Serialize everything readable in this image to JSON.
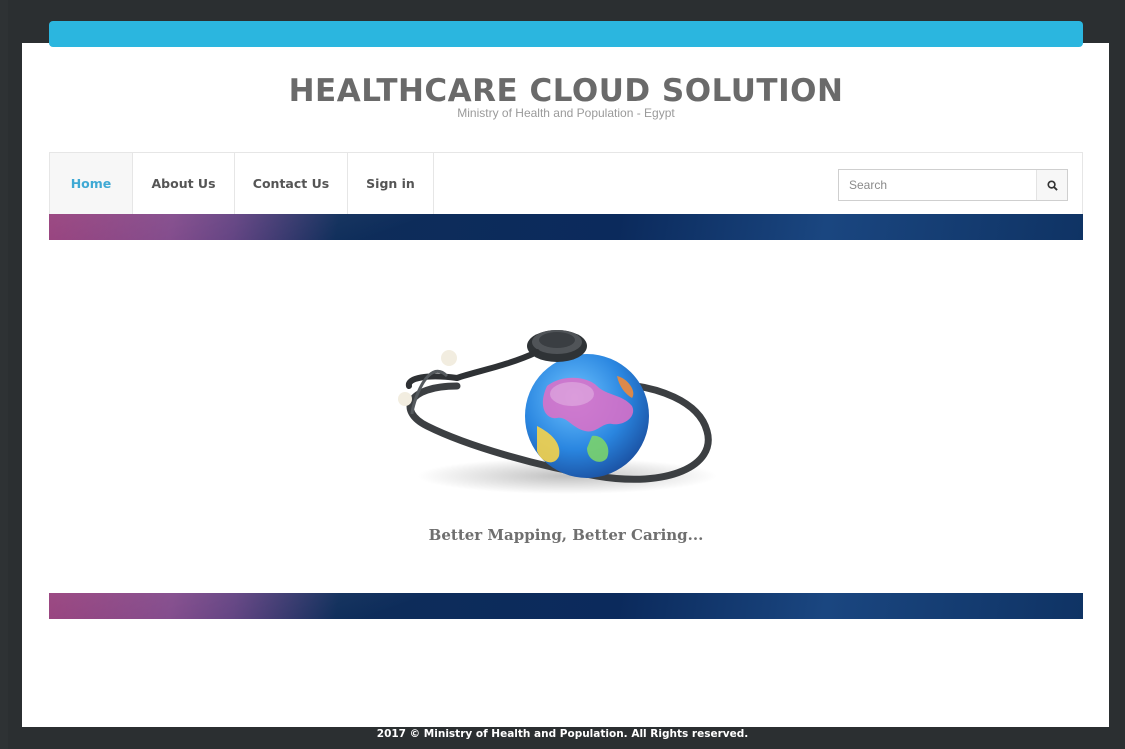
{
  "header": {
    "title": "HEALTHCARE CLOUD SOLUTION",
    "subtitle": "Ministry of Health and Population - Egypt"
  },
  "nav": {
    "items": [
      {
        "label": "Home",
        "active": true
      },
      {
        "label": "About Us",
        "active": false
      },
      {
        "label": "Contact Us",
        "active": false
      },
      {
        "label": "Sign in",
        "active": false
      }
    ]
  },
  "search": {
    "placeholder": "Search",
    "value": "",
    "icon": "search-icon"
  },
  "hero": {
    "image": "globe-with-stethoscope",
    "tagline": "Better Mapping, Better Caring..."
  },
  "footer": {
    "text": "2017 © Ministry of Health and Population. All Rights reserved."
  },
  "colors": {
    "accent": "#2bb6df",
    "active_nav": "#3fa9d4",
    "title": "#6a6a6a",
    "band_dark": "#0b2a5c",
    "band_magenta": "#8b2b6e"
  }
}
